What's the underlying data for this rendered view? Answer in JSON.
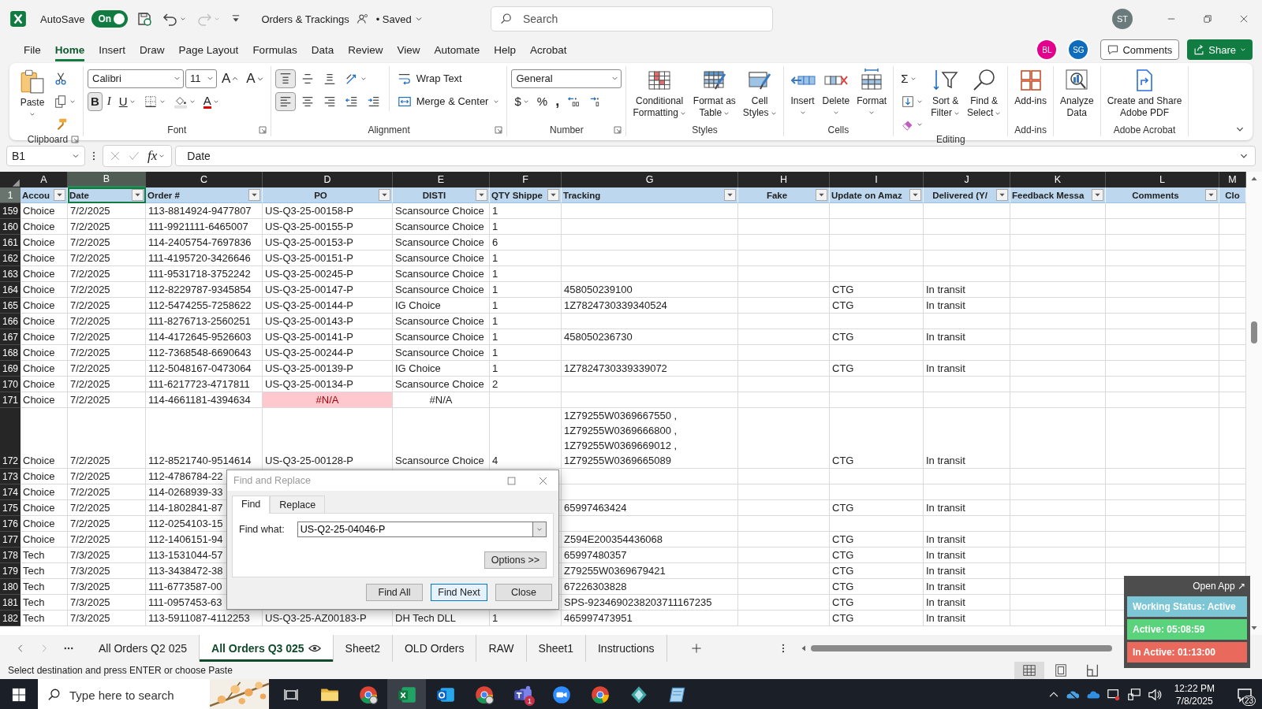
{
  "title_bar": {
    "autosave": {
      "label": "AutoSave",
      "on": true,
      "state": "On"
    },
    "quick_access": [
      {
        "kind": "save",
        "caret": false,
        "disabled": false
      },
      {
        "kind": "undo",
        "caret": true,
        "disabled": false
      },
      {
        "kind": "redo",
        "caret": true,
        "disabled": true
      },
      {
        "kind": "customize",
        "caret": false,
        "disabled": false
      }
    ],
    "document_title": "Orders & Trackings",
    "save_status": "• Saved",
    "search_placeholder": "Search",
    "account_initials": "ST"
  },
  "menu_tabs": [
    {
      "label": "File",
      "selected": false
    },
    {
      "label": "Home",
      "selected": true
    },
    {
      "label": "Insert",
      "selected": false
    },
    {
      "label": "Draw",
      "selected": false
    },
    {
      "label": "Page Layout",
      "selected": false
    },
    {
      "label": "Formulas",
      "selected": false
    },
    {
      "label": "Data",
      "selected": false
    },
    {
      "label": "Review",
      "selected": false
    },
    {
      "label": "View",
      "selected": false
    },
    {
      "label": "Automate",
      "selected": false
    },
    {
      "label": "Help",
      "selected": false
    },
    {
      "label": "Acrobat",
      "selected": false
    }
  ],
  "collaborators": [
    {
      "initials": "BL",
      "color": "#e3008c"
    },
    {
      "initials": "SG",
      "color": "#0f6cbd"
    }
  ],
  "comments_button": "Comments",
  "share_button": "Share",
  "ribbon": {
    "groups": [
      {
        "label": "Clipboard",
        "launcher": true,
        "columns": [
          {
            "kind": "paste",
            "label": "Paste",
            "caret": true
          },
          {
            "lines": [
              {
                "buttons": [
                  {
                    "kind": "cut"
                  }
                ]
              },
              {
                "buttons": [
                  {
                    "kind": "copy",
                    "caret": true
                  }
                ]
              },
              {
                "buttons": [
                  {
                    "kind": "format-painter"
                  }
                ]
              }
            ]
          }
        ]
      },
      {
        "label": "Font",
        "launcher": true,
        "columns": [
          {
            "lines": [
              {
                "buttons": [
                  {
                    "kind": "font-combo",
                    "value": "Calibri"
                  },
                  {
                    "kind": "size-combo",
                    "value": "11"
                  },
                  {
                    "kind": "grow-font",
                    "label": "A"
                  },
                  {
                    "kind": "shrink-font",
                    "label": "A"
                  }
                ]
              },
              {
                "buttons": [
                  {
                    "kind": "bold",
                    "label": "B",
                    "selected": true
                  },
                  {
                    "kind": "italic",
                    "label": "I",
                    "selected": false
                  },
                  {
                    "kind": "underline",
                    "label": "U",
                    "selected": false,
                    "caret": true
                  },
                  {
                    "kind": "borders",
                    "caret": true
                  },
                  {
                    "kind": "fill-color",
                    "caret": true
                  },
                  {
                    "kind": "font-color",
                    "label": "A",
                    "caret": true
                  }
                ]
              }
            ]
          }
        ]
      },
      {
        "label": "Alignment",
        "launcher": true,
        "columns": [
          {
            "lines": [
              {
                "buttons": [
                  {
                    "kind": "align-top",
                    "selected": true
                  },
                  {
                    "kind": "align-middle",
                    "selected": false
                  },
                  {
                    "kind": "align-bottom",
                    "selected": false
                  },
                  {
                    "kind": "orientation",
                    "caret": true
                  }
                ]
              },
              {
                "buttons": [
                  {
                    "kind": "align-left",
                    "selected": true
                  },
                  {
                    "kind": "align-center",
                    "selected": false
                  },
                  {
                    "kind": "align-right",
                    "selected": false
                  },
                  {
                    "kind": "indent-decrease"
                  },
                  {
                    "kind": "indent-increase"
                  }
                ]
              }
            ]
          },
          {
            "lines": [
              {
                "buttons": [
                  {
                    "kind": "wrap-text",
                    "label": "Wrap Text"
                  }
                ]
              },
              {
                "buttons": [
                  {
                    "kind": "merge-center",
                    "label": "Merge & Center",
                    "caret": true
                  }
                ]
              }
            ]
          }
        ]
      },
      {
        "label": "Number",
        "launcher": true,
        "columns": [
          {
            "lines": [
              {
                "buttons": [
                  {
                    "kind": "number-format-combo",
                    "value": "General"
                  }
                ]
              },
              {
                "buttons": [
                  {
                    "kind": "currency",
                    "label": "$",
                    "caret": true
                  },
                  {
                    "kind": "percent",
                    "label": "%"
                  },
                  {
                    "kind": "comma-style",
                    "label": ","
                  },
                  {
                    "kind": "decimal-increase"
                  },
                  {
                    "kind": "decimal-decrease"
                  }
                ]
              }
            ]
          }
        ]
      },
      {
        "label": "Styles",
        "launcher": false,
        "columns": [
          {
            "kind": "conditional-formatting",
            "label": "Conditional\nFormatting",
            "caret": true
          },
          {
            "kind": "format-as-table",
            "label": "Format as\nTable",
            "caret": true
          },
          {
            "kind": "cell-styles",
            "label": "Cell\nStyles",
            "caret": true
          }
        ]
      },
      {
        "label": "Cells",
        "launcher": false,
        "columns": [
          {
            "kind": "insert-cells",
            "label": "Insert",
            "caret": true
          },
          {
            "kind": "delete-cells",
            "label": "Delete",
            "caret": true
          },
          {
            "kind": "format-cells",
            "label": "Format",
            "caret": true
          }
        ]
      },
      {
        "label": "Editing",
        "launcher": false,
        "columns": [
          {
            "lines": [
              {
                "buttons": [
                  {
                    "kind": "autosum",
                    "label": "Σ",
                    "caret": true
                  }
                ]
              },
              {
                "buttons": [
                  {
                    "kind": "fill-down",
                    "caret": true
                  }
                ]
              },
              {
                "buttons": [
                  {
                    "kind": "clear",
                    "caret": true
                  }
                ]
              }
            ]
          },
          {
            "kind": "sort-filter",
            "label": "Sort &\nFilter",
            "caret": true
          },
          {
            "kind": "find-select",
            "label": "Find &\nSelect",
            "caret": true
          }
        ]
      },
      {
        "label": "Add-ins",
        "launcher": false,
        "columns": [
          {
            "kind": "add-ins",
            "label": "Add-ins",
            "caret": false
          }
        ]
      },
      {
        "columns": [
          {
            "kind": "analyze-data",
            "label": "Analyze\nData",
            "caret": false
          }
        ]
      },
      {
        "label": "Adobe Acrobat",
        "launcher": false,
        "columns": [
          {
            "kind": "adobe-pdf",
            "label": "Create and Share\nAdobe PDF",
            "caret": false
          }
        ]
      }
    ]
  },
  "formula_bar": {
    "name_box": "B1",
    "function_label": "fx",
    "formula": "Date"
  },
  "sheet": {
    "columns": [
      {
        "letter": "A",
        "selected": false
      },
      {
        "letter": "B",
        "selected": true
      },
      {
        "letter": "C",
        "selected": false
      },
      {
        "letter": "D",
        "selected": false
      },
      {
        "letter": "E",
        "selected": false
      },
      {
        "letter": "F",
        "selected": false
      },
      {
        "letter": "G",
        "selected": false
      },
      {
        "letter": "H",
        "selected": false
      },
      {
        "letter": "I",
        "selected": false
      },
      {
        "letter": "J",
        "selected": false
      },
      {
        "letter": "K",
        "selected": false
      },
      {
        "letter": "L",
        "selected": false
      },
      {
        "letter": "M",
        "selected": false
      }
    ],
    "header_row": {
      "number": "1",
      "selected": true,
      "cells": [
        {
          "text": "Accou",
          "filter": true,
          "selected": false
        },
        {
          "text": "Date",
          "filter": true,
          "selected": true
        },
        {
          "text": "Order #",
          "filter": true,
          "selected": false
        },
        {
          "text": "PO",
          "filter": true,
          "selected": false
        },
        {
          "text": "DISTI",
          "filter": true,
          "selected": false
        },
        {
          "text": "QTY Shippe",
          "filter": true,
          "selected": false
        },
        {
          "text": "Tracking",
          "filter": true,
          "selected": false
        },
        {
          "text": "Fake",
          "filter": true,
          "selected": false
        },
        {
          "text": "Update on Amaz",
          "filter": true,
          "selected": false
        },
        {
          "text": "Delivered (Y/",
          "filter": true,
          "selected": false
        },
        {
          "text": "Feedback Messa",
          "filter": true,
          "selected": false
        },
        {
          "text": "Comments",
          "filter": true,
          "selected": false
        },
        {
          "text": "Clo",
          "filter": false,
          "selected": false
        }
      ]
    },
    "rows": [
      {
        "number": "159",
        "cells": {
          "A": "Choice",
          "B": "7/2/2025",
          "C": "113-8814924-9477807",
          "D": "US-Q3-25-00158-P",
          "E": "Scansource Choice",
          "F": "1"
        }
      },
      {
        "number": "160",
        "cells": {
          "A": "Choice",
          "B": "7/2/2025",
          "C": "111-9921111-6465007",
          "D": "US-Q3-25-00155-P",
          "E": "Scansource Choice",
          "F": "1"
        }
      },
      {
        "number": "161",
        "cells": {
          "A": "Choice",
          "B": "7/2/2025",
          "C": "114-2405754-7697836",
          "D": "US-Q3-25-00153-P",
          "E": "Scansource Choice",
          "F": "6"
        }
      },
      {
        "number": "162",
        "cells": {
          "A": "Choice",
          "B": "7/2/2025",
          "C": "111-4195720-3426646",
          "D": "US-Q3-25-00151-P",
          "E": "Scansource Choice",
          "F": "1"
        }
      },
      {
        "number": "163",
        "cells": {
          "A": "Choice",
          "B": "7/2/2025",
          "C": "111-9531718-3752242",
          "D": "US-Q3-25-00245-P",
          "E": "Scansource Choice",
          "F": "1"
        }
      },
      {
        "number": "164",
        "cells": {
          "A": "Choice",
          "B": "7/2/2025",
          "C": "112-8229787-9345854",
          "D": "US-Q3-25-00147-P",
          "E": "Scansource Choice",
          "F": "1",
          "G": "458050239100",
          "I": "CTG",
          "J": "In transit"
        }
      },
      {
        "number": "165",
        "cells": {
          "A": "Choice",
          "B": "7/2/2025",
          "C": "112-5474255-7258622",
          "D": "US-Q3-25-00144-P",
          "E": "IG Choice",
          "F": "1",
          "G": "1Z7824730339340524",
          "I": "CTG",
          "J": "In transit"
        }
      },
      {
        "number": "166",
        "cells": {
          "A": "Choice",
          "B": "7/2/2025",
          "C": "111-8276713-2560251",
          "D": "US-Q3-25-00143-P",
          "E": "Scansource Choice",
          "F": "1"
        }
      },
      {
        "number": "167",
        "cells": {
          "A": "Choice",
          "B": "7/2/2025",
          "C": "114-4172645-9526603",
          "D": "US-Q3-25-00141-P",
          "E": "Scansource Choice",
          "F": "1",
          "G": "458050236730",
          "I": "CTG",
          "J": "In transit"
        }
      },
      {
        "number": "168",
        "cells": {
          "A": "Choice",
          "B": "7/2/2025",
          "C": "112-7368548-6690643",
          "D": "US-Q3-25-00244-P",
          "E": "Scansource Choice",
          "F": "1"
        }
      },
      {
        "number": "169",
        "cells": {
          "A": "Choice",
          "B": "7/2/2025",
          "C": "112-5048167-0473064",
          "D": "US-Q3-25-00139-P",
          "E": "IG Choice",
          "F": "1",
          "G": "1Z7824730339339072",
          "I": "CTG",
          "J": "In transit"
        }
      },
      {
        "number": "170",
        "cells": {
          "A": "Choice",
          "B": "7/2/2025",
          "C": "111-6217723-4717811",
          "D": "US-Q3-25-00134-P",
          "E": "Scansource Choice",
          "F": "2"
        }
      },
      {
        "number": "171",
        "cells": {
          "A": "Choice",
          "B": "7/2/2025",
          "C": "114-4661181-4394634",
          "D": {
            "text": "#N/A",
            "kind": "error",
            "highlight": true
          },
          "E": {
            "text": "#N/A",
            "kind": "error",
            "highlight": false
          }
        }
      },
      {
        "number": "172",
        "cells": {
          "A": "Choice",
          "B": "7/2/2025",
          "C": "112-8521740-9514614",
          "D": "US-Q3-25-00128-P",
          "E": "Scansource Choice",
          "F": "4",
          "G": "1Z79255W0369667550 ,\n1Z79255W0369666800 ,\n1Z79255W0369669012 ,\n1Z79255W0369665089",
          "I": "CTG",
          "J": "In transit"
        }
      },
      {
        "number": "173",
        "cells": {
          "A": "Choice",
          "B": "7/2/2025",
          "C": "112-4786784-22"
        }
      },
      {
        "number": "174",
        "cells": {
          "A": "Choice",
          "B": "7/2/2025",
          "C": "114-0268939-33"
        }
      },
      {
        "number": "175",
        "cells": {
          "A": "Choice",
          "B": "7/2/2025",
          "C": "114-1802841-87",
          "G": "65997463424",
          "I": "CTG",
          "J": "In transit"
        }
      },
      {
        "number": "176",
        "cells": {
          "A": "Choice",
          "B": "7/2/2025",
          "C": "112-0254103-15"
        }
      },
      {
        "number": "177",
        "cells": {
          "A": "Choice",
          "B": "7/2/2025",
          "C": "112-1406151-94",
          "G": "Z594E200354436068",
          "I": "CTG",
          "J": "In transit"
        }
      },
      {
        "number": "178",
        "cells": {
          "A": "Tech",
          "B": "7/3/2025",
          "C": "113-1531044-57",
          "G": "65997480357",
          "I": "CTG",
          "J": "In transit"
        }
      },
      {
        "number": "179",
        "cells": {
          "A": "Tech",
          "B": "7/3/2025",
          "C": "113-3438472-38",
          "G": "Z79255W0369679421",
          "I": "CTG",
          "J": "In transit"
        }
      },
      {
        "number": "180",
        "cells": {
          "A": "Tech",
          "B": "7/3/2025",
          "C": "111-6773587-00",
          "G": "67226303828",
          "I": "CTG",
          "J": "In transit"
        }
      },
      {
        "number": "181",
        "cells": {
          "A": "Tech",
          "B": "7/3/2025",
          "C": "111-0957453-63",
          "G": "SPS-9234690238203711167235",
          "I": "CTG",
          "J": "In transit"
        }
      },
      {
        "number": "182",
        "cells": {
          "A": "Tech",
          "B": "7/3/2025",
          "C": "113-5911087-4112253",
          "D": "US-Q3-25-AZ00183-P",
          "E": "DH Tech DLL",
          "F": "1",
          "G": "465997473951",
          "I": "CTG",
          "J": "In transit"
        }
      }
    ]
  },
  "sheet_tabs": [
    {
      "label": "All Orders Q2 025",
      "selected": false,
      "watching": false
    },
    {
      "label": "All Orders Q3 025",
      "selected": true,
      "watching": true
    },
    {
      "label": "Sheet2",
      "selected": false,
      "watching": false
    },
    {
      "label": "OLD Orders",
      "selected": false,
      "watching": false
    },
    {
      "label": "RAW",
      "selected": false,
      "watching": false
    },
    {
      "label": "Sheet1",
      "selected": false,
      "watching": false
    },
    {
      "label": "Instructions",
      "selected": false,
      "watching": false
    }
  ],
  "status_bar": {
    "message": "Select destination and press ENTER or choose Paste",
    "views": [
      {
        "kind": "normal",
        "selected": true
      },
      {
        "kind": "page-layout",
        "selected": false
      },
      {
        "kind": "page-break",
        "selected": false
      }
    ]
  },
  "find_dialog": {
    "title": "Find and Replace",
    "tabs": [
      {
        "label": "Find",
        "selected": true
      },
      {
        "label": "Replace",
        "selected": false
      }
    ],
    "find_label": "Find what:",
    "find_value": "US-Q2-25-04046-P",
    "options_button": "Options >>",
    "buttons": [
      {
        "label": "Find All",
        "default": false
      },
      {
        "label": "Find Next",
        "default": true
      },
      {
        "label": "Close",
        "default": false
      }
    ]
  },
  "tracker_widget": {
    "open_app": "Open App ↗",
    "rows": [
      {
        "text": "Working Status: Active",
        "color": "#7cc6d6"
      },
      {
        "text": "Active: 05:08:59",
        "color": "#5bd37c"
      },
      {
        "text": "In Active: 01:13:00",
        "color": "#e96a5c"
      }
    ]
  },
  "taskbar": {
    "search_placeholder": "Type here to search",
    "apps": [
      {
        "kind": "folder",
        "selected": false
      },
      {
        "kind": "browser-profile",
        "selected": false
      },
      {
        "kind": "spreadsheet",
        "selected": true
      },
      {
        "kind": "mail",
        "selected": false
      },
      {
        "kind": "browser-profile",
        "selected": false
      },
      {
        "kind": "team-chat",
        "selected": false,
        "badge": "1"
      },
      {
        "kind": "video-call",
        "selected": false
      },
      {
        "kind": "browser",
        "selected": false
      },
      {
        "kind": "diamond",
        "selected": false
      },
      {
        "kind": "notepad",
        "selected": false
      }
    ],
    "time": "12:22 PM",
    "date": "7/8/2025",
    "notifications": "23"
  }
}
